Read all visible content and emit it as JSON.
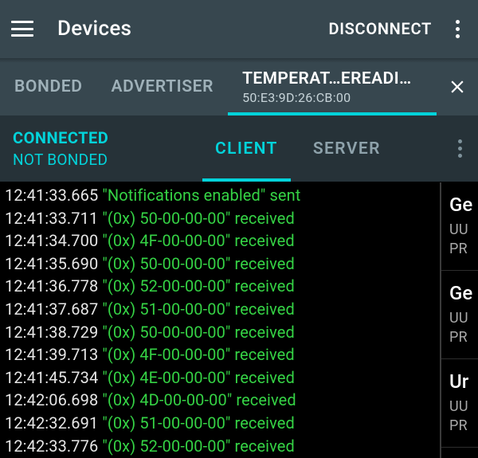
{
  "appbar": {
    "title": "Devices",
    "action": "DISCONNECT"
  },
  "tabs": {
    "items": [
      {
        "label": "BONDED"
      },
      {
        "label": "ADVERTISER"
      }
    ],
    "device": {
      "name": "TEMPERAT…EREADING",
      "mac": "50:E3:9D:26:CB:00"
    }
  },
  "status": {
    "conn": "CONNECTED",
    "bond": "NOT BONDED"
  },
  "subtabs": {
    "client": "CLIENT",
    "server": "SERVER"
  },
  "log": [
    {
      "ts": "12:41:33.665",
      "msg": "\"Notifications enabled\" sent"
    },
    {
      "ts": "12:41:33.711",
      "msg": "\"(0x) 50-00-00-00\" received"
    },
    {
      "ts": "12:41:34.700",
      "msg": "\"(0x) 4F-00-00-00\" received"
    },
    {
      "ts": "12:41:35.690",
      "msg": "\"(0x) 50-00-00-00\" received"
    },
    {
      "ts": "12:41:36.778",
      "msg": "\"(0x) 52-00-00-00\" received"
    },
    {
      "ts": "12:41:37.687",
      "msg": "\"(0x) 51-00-00-00\" received"
    },
    {
      "ts": "12:41:38.729",
      "msg": "\"(0x) 50-00-00-00\" received"
    },
    {
      "ts": "12:41:39.713",
      "msg": "\"(0x) 4F-00-00-00\" received"
    },
    {
      "ts": "12:41:45.734",
      "msg": "\"(0x) 4E-00-00-00\" received"
    },
    {
      "ts": "12:42:06.698",
      "msg": "\"(0x) 4D-00-00-00\" received"
    },
    {
      "ts": "12:42:32.691",
      "msg": "\"(0x) 51-00-00-00\" received"
    },
    {
      "ts": "12:42:33.776",
      "msg": "\"(0x) 52-00-00-00\" received"
    }
  ],
  "side": [
    {
      "hdr": "Ge",
      "l1": "UU",
      "l2": "PR"
    },
    {
      "hdr": "Ge",
      "l1": "UU",
      "l2": "PR"
    },
    {
      "hdr": "Ur",
      "l1": "UU",
      "l2": "PR"
    }
  ]
}
